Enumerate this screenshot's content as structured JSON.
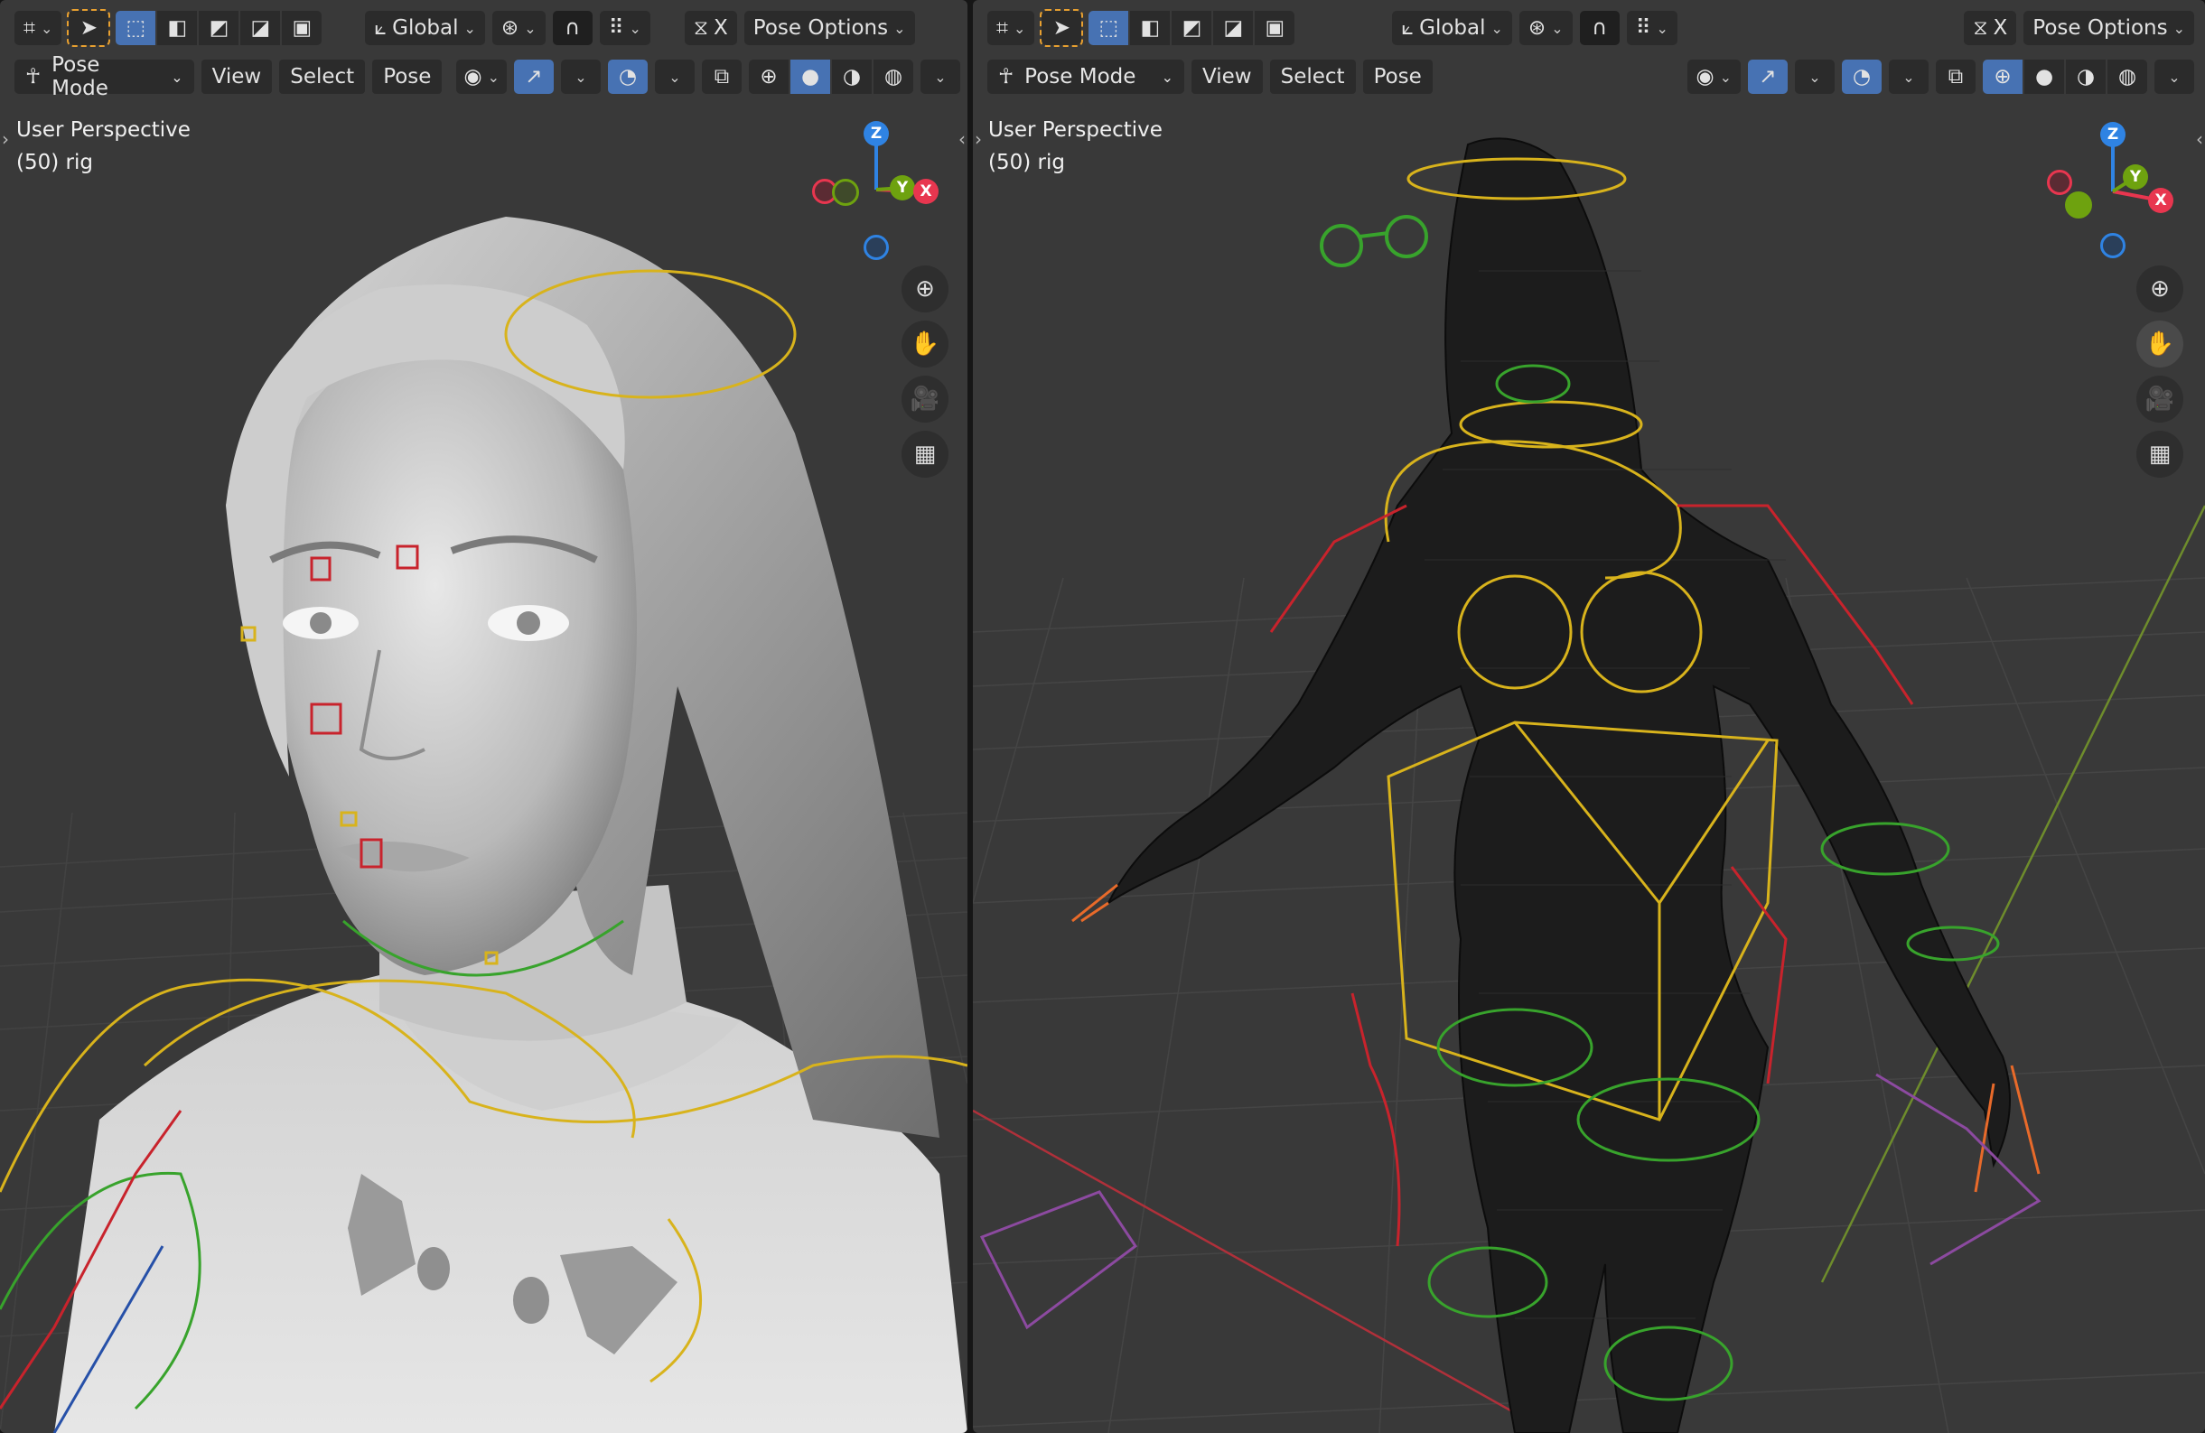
{
  "left_viewport": {
    "header": {
      "transform_orientation": "Global",
      "pose_options_label": "Pose Options",
      "axis_x_label": "X"
    },
    "menubar": {
      "mode_label": "Pose Mode",
      "menus": [
        "View",
        "Select",
        "Pose"
      ]
    },
    "overlay": {
      "view_name": "User Perspective",
      "object_info": "(50) rig"
    },
    "gizmo": {
      "z": "Z",
      "y": "Y",
      "x": "X"
    },
    "shading": "solid"
  },
  "right_viewport": {
    "header": {
      "transform_orientation": "Global",
      "pose_options_label": "Pose Options",
      "axis_x_label": "X"
    },
    "menubar": {
      "mode_label": "Pose Mode",
      "menus": [
        "View",
        "Select",
        "Pose"
      ]
    },
    "overlay": {
      "view_name": "User Perspective",
      "object_info": "(50) rig"
    },
    "gizmo": {
      "z": "Z",
      "y": "Y",
      "x": "X"
    },
    "shading": "wireframe"
  },
  "colors": {
    "active_button": "#4772b3",
    "viewport_bg": "#393939",
    "axis_x": "#e8364f",
    "axis_y": "#6ea20f",
    "axis_z": "#2f83e3",
    "bone_yellow": "#d8b31c",
    "bone_red": "#c8232c",
    "bone_green": "#38a32c",
    "bone_blue": "#2650a8"
  }
}
